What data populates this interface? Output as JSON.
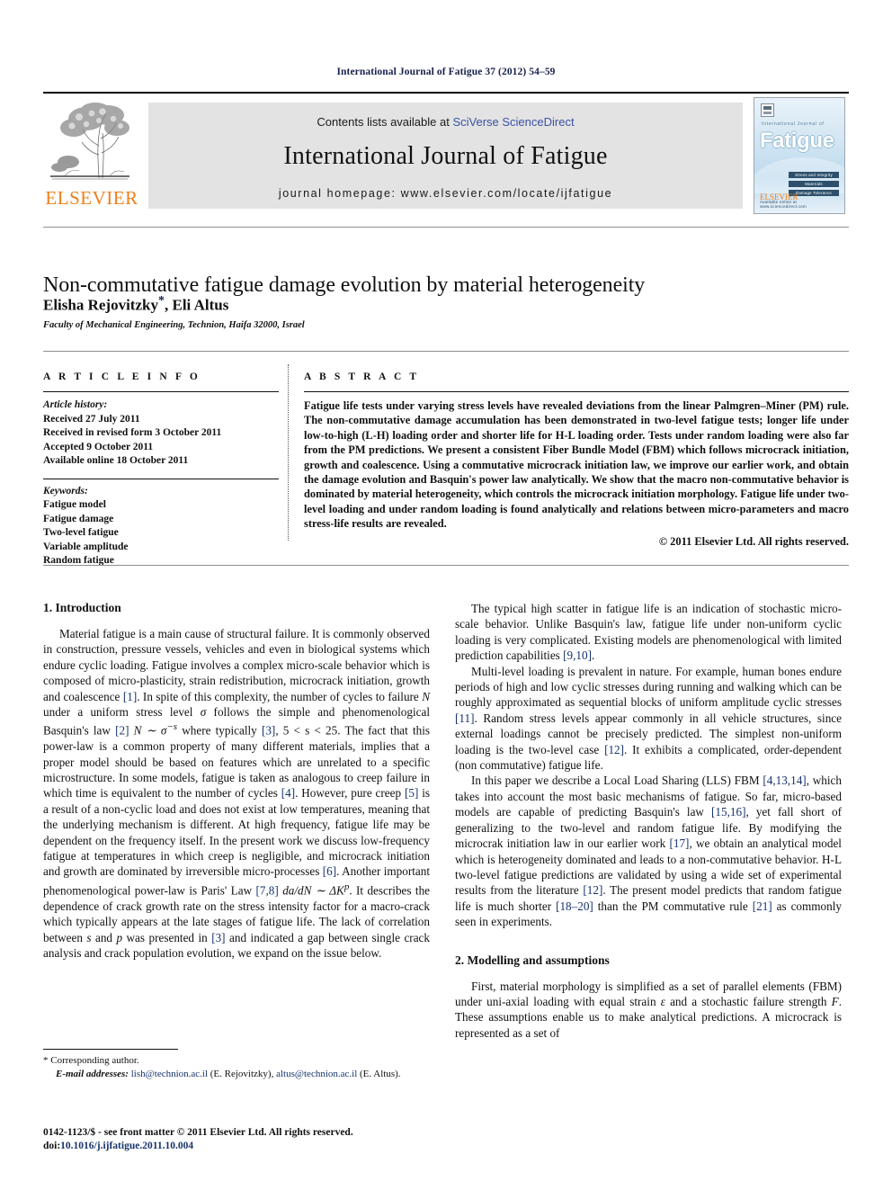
{
  "running_head": "International Journal of Fatigue 37 (2012) 54–59",
  "masthead": {
    "publisher_logo_label": "ELSEVIER",
    "contents_prefix": "Contents lists available at ",
    "contents_link": "SciVerse ScienceDirect",
    "journal_title": "International Journal of Fatigue",
    "homepage": "journal homepage: www.elsevier.com/locate/ijfatigue",
    "cover": {
      "superline": "International Journal of",
      "title": "Fatigue",
      "bars": [
        "Stress and Integrity",
        "Materials",
        "Damage Tolerance"
      ],
      "footer_logo": "ELSEVIER",
      "footer_text": "Available online at www.sciencedirect.com"
    }
  },
  "article": {
    "title": "Non-commutative fatigue damage evolution by material heterogeneity",
    "authors_plain": "Elisha Rejovitzky",
    "authors_rest": ", Eli Altus",
    "corresponding_marker": "*",
    "affiliation": "Faculty of Mechanical Engineering, Technion, Haifa 32000, Israel"
  },
  "article_info": {
    "heading": "A R T I C L E  I N F O",
    "history_label": "Article history:",
    "history": [
      "Received 27 July 2011",
      "Received in revised form 3 October 2011",
      "Accepted 9 October 2011",
      "Available online 18 October 2011"
    ],
    "keywords_label": "Keywords:",
    "keywords": [
      "Fatigue model",
      "Fatigue damage",
      "Two-level fatigue",
      "Variable amplitude",
      "Random fatigue"
    ]
  },
  "abstract": {
    "heading": "A B S T R A C T",
    "text": "Fatigue life tests under varying stress levels have revealed deviations from the linear Palmgren–Miner (PM) rule. The non-commutative damage accumulation has been demonstrated in two-level fatigue tests; longer life under low-to-high (L-H) loading order and shorter life for H-L loading order. Tests under random loading were also far from the PM predictions. We present a consistent Fiber Bundle Model (FBM) which follows microcrack initiation, growth and coalescence. Using a commutative microcrack initiation law, we improve our earlier work, and obtain the damage evolution and Basquin's power law analytically. We show that the macro non-commutative behavior is dominated by material heterogeneity, which controls the microcrack initiation morphology. Fatigue life under two-level loading and under random loading is found analytically and relations between micro-parameters and macro stress-life results are revealed.",
    "copyright": "© 2011 Elsevier Ltd. All rights reserved."
  },
  "sections": {
    "intro_heading": "1. Introduction",
    "modelling_heading": "2. Modelling and assumptions"
  },
  "body": {
    "left_p1_a": "Material fatigue is a main cause of structural failure. It is commonly observed in construction, pressure vessels, vehicles and even in biological systems which endure cyclic loading. Fatigue involves a complex micro-scale behavior which is composed of micro-plasticity, strain redistribution, microcrack initiation, growth and coalescence ",
    "left_p1_r1": "[1]",
    "left_p1_b": ". In spite of this complexity, the number of cycles to failure ",
    "left_p1_i1": "N",
    "left_p1_c": " under a uniform stress level ",
    "left_p1_i2": "σ",
    "left_p1_d": " follows the simple and phenomenological Basquin's law ",
    "left_p1_r2": "[2]",
    "left_p1_e": " ",
    "left_p1_eq": "N ∼ σ",
    "left_p1_exp": "−s",
    "left_p1_f": " where typically ",
    "left_p1_r3": "[3]",
    "left_p1_g": ", 5 < s < 25. The fact that this power-law is a common property of many different materials, implies that a proper model should be based on features which are unrelated to a specific microstructure. In some models, fatigue is taken as analogous to creep failure in which time is equivalent to the number of cycles ",
    "left_p1_r4": "[4]",
    "left_p1_h": ". However, pure creep ",
    "left_p1_r5": "[5]",
    "left_p1_i": " is a result of a non-cyclic load and does not exist at low temperatures, meaning that the underlying mechanism is different. At high frequency, fatigue life may be dependent on the frequency itself. In the present work we discuss low-frequency fatigue at temperatures in which creep is negligible, and microcrack initiation and growth are dominated by irreversible micro-processes ",
    "left_p1_r6": "[6]",
    "left_p1_j": ". Another important phenomenological power-law is Paris' Law ",
    "left_p1_r7": "[7,8]",
    "left_p1_k": " ",
    "left_p1_eq2": "da/dN ∼ ΔK",
    "left_p1_exp2": "p",
    "left_p1_l": ". It describes the dependence of crack growth rate on the stress intensity factor for a macro-crack which typically appears at the late stages of fatigue life. The lack of correlation between ",
    "left_p1_i3": "s",
    "left_p1_m": " and ",
    "left_p1_i4": "p",
    "left_p1_n": " was presented in ",
    "left_p1_r8": "[3]",
    "left_p1_o": " and indicated a gap between single crack analysis and crack population evolution, we expand on the issue below.",
    "right_p1_a": "The typical high scatter in fatigue life is an indication of stochastic micro-scale behavior. Unlike Basquin's law, fatigue life under non-uniform cyclic loading is very complicated. Existing models are phenomenological with limited prediction capabilities ",
    "right_p1_r1": "[9,10]",
    "right_p1_b": ".",
    "right_p2_a": "Multi-level loading is prevalent in nature. For example, human bones endure periods of high and low cyclic stresses during running and walking which can be roughly approximated as sequential blocks of uniform amplitude cyclic stresses ",
    "right_p2_r1": "[11]",
    "right_p2_b": ". Random stress levels appear commonly in all vehicle structures, since external loadings cannot be precisely predicted. The simplest non-uniform loading is the two-level case ",
    "right_p2_r2": "[12]",
    "right_p2_c": ". It exhibits a complicated, order-dependent (non commutative) fatigue life.",
    "right_p3_a": "In this paper we describe a Local Load Sharing (LLS) FBM ",
    "right_p3_r1": "[4,13,14]",
    "right_p3_b": ", which takes into account the most basic mechanisms of fatigue. So far, micro-based models are capable of predicting Basquin's law ",
    "right_p3_r2": "[15,16]",
    "right_p3_c": ", yet fall short of generalizing to the two-level and random fatigue life. By modifying the microcrak initiation law in our earlier work ",
    "right_p3_r3": "[17]",
    "right_p3_d": ", we obtain an analytical model which is heterogeneity dominated and leads to a non-commutative behavior. H-L two-level fatigue predictions are validated by using a wide set of experimental results from the literature ",
    "right_p3_r4": "[12]",
    "right_p3_e": ". The present model predicts that random fatigue life is much shorter ",
    "right_p3_r5": "[18–20]",
    "right_p3_f": " than the PM commutative rule ",
    "right_p3_r6": "[21]",
    "right_p3_g": " as commonly seen in experiments.",
    "right_p4_a": "First, material morphology is simplified as a set of parallel elements (FBM) under uni-axial loading with equal strain ",
    "right_p4_i1": "ε",
    "right_p4_b": " and a stochastic failure strength ",
    "right_p4_i2": "F",
    "right_p4_c": ". These assumptions enable us to make analytical predictions. A microcrack is represented as a set of"
  },
  "footer": {
    "corresponding_marker": "*",
    "corresponding_text": " Corresponding author.",
    "email_label": "E-mail addresses:",
    "email_1": "lish@technion.ac.il",
    "email_1_name": " (E. Rejovitzky), ",
    "email_2": "altus@technion.ac.il",
    "email_2_name": " (E. Altus).",
    "issn_line": "0142-1123/$ - see front matter © 2011 Elsevier Ltd. All rights reserved.",
    "doi_label": "doi:",
    "doi_value": "10.1016/j.ijfatigue.2011.10.004"
  },
  "colors": {
    "link": "#3b51a3",
    "reference": "#16336b",
    "elsevier_orange": "#f07f1a",
    "banner_gray": "#e3e3e3",
    "running_head": "#16214d"
  }
}
